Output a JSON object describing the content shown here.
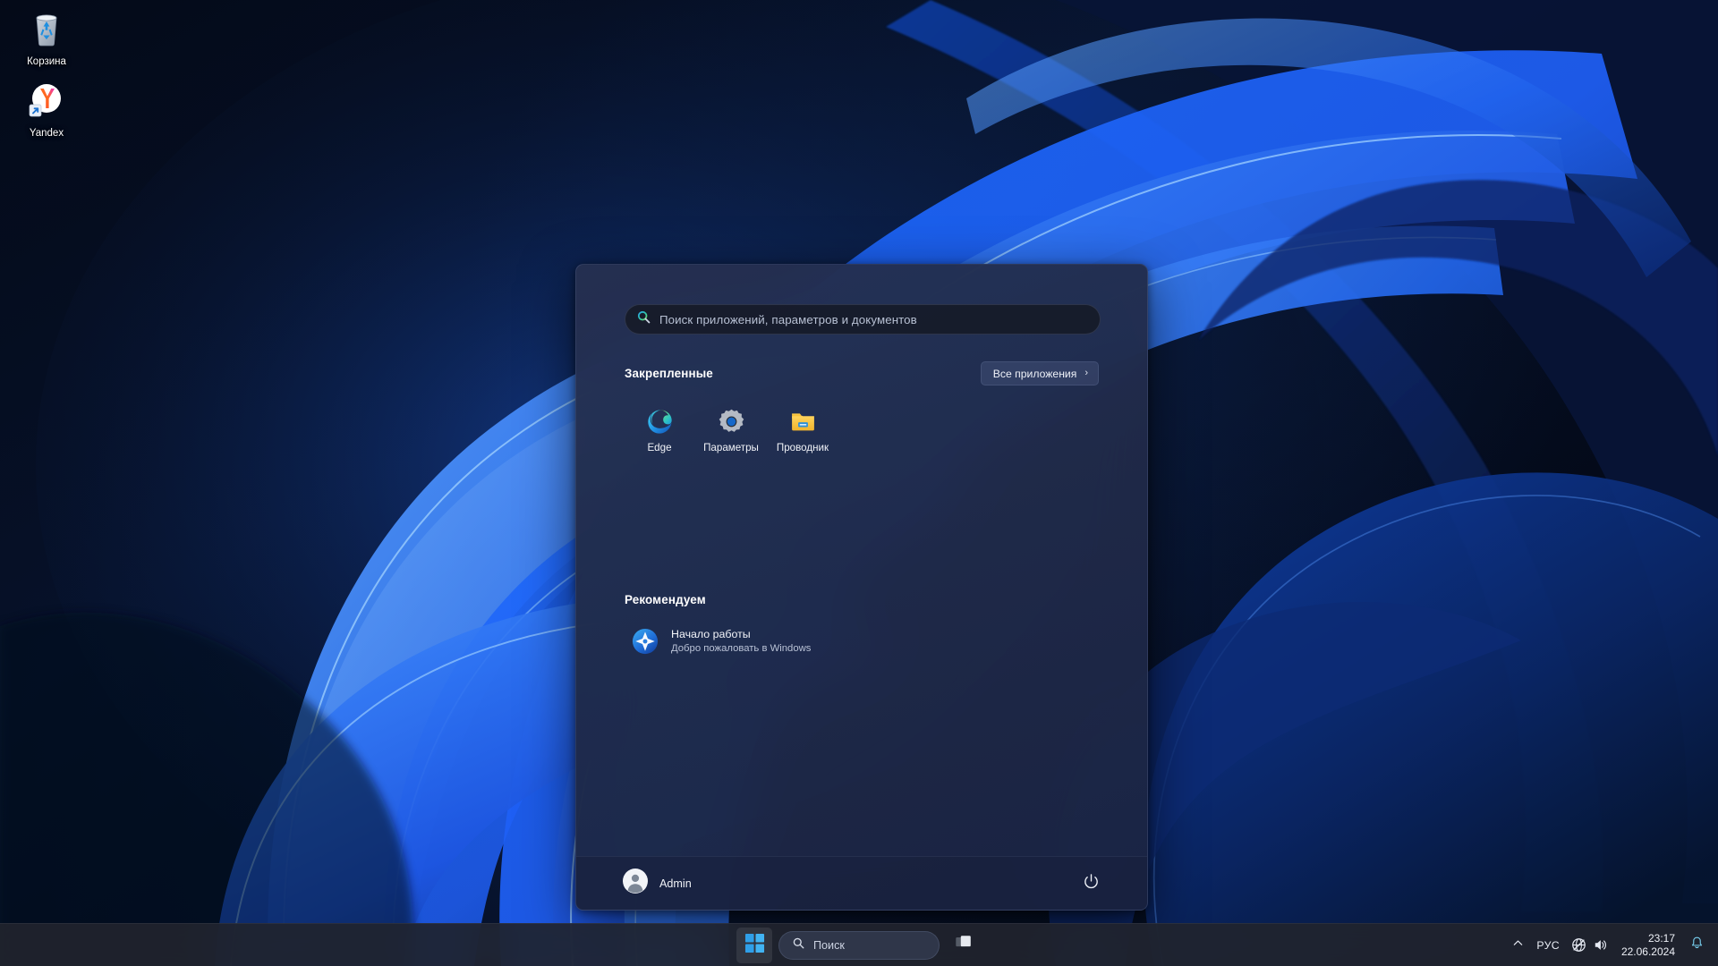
{
  "desktop": {
    "icons": [
      {
        "name": "recycle-bin",
        "label": "Корзина",
        "icon": "recycle-bin-icon"
      },
      {
        "name": "yandex-browser",
        "label": "Yandex",
        "icon": "yandex-icon",
        "shortcut": true
      }
    ]
  },
  "start_menu": {
    "search": {
      "placeholder": "Поиск приложений, параметров и документов",
      "value": "",
      "icon": "search-icon"
    },
    "pinned": {
      "title": "Закрепленные",
      "all_apps_label": "Все приложения",
      "all_apps_chevron": "›",
      "apps": [
        {
          "label": "Edge",
          "icon": "edge-icon"
        },
        {
          "label": "Параметры",
          "icon": "settings-gear-icon"
        },
        {
          "label": "Проводник",
          "icon": "file-explorer-icon"
        }
      ]
    },
    "recommended": {
      "title": "Рекомендуем",
      "items": [
        {
          "title": "Начало работы",
          "subtitle": "Добро пожаловать в Windows",
          "icon": "get-started-icon"
        }
      ]
    },
    "footer": {
      "user_name": "Admin",
      "user_icon": "user-avatar-icon",
      "power_icon": "power-icon"
    }
  },
  "taskbar": {
    "start_button_label": "Пуск",
    "search": {
      "placeholder": "Поиск",
      "value": "",
      "icon": "search-icon"
    },
    "task_view_label": "Представление задач",
    "tray": {
      "overflow_chevron": "⌃",
      "language": "РУС",
      "network_icon": "network-disconnected-icon",
      "volume_icon": "volume-icon",
      "time": "23:17",
      "date": "22.06.2024",
      "notification_icon": "bell-icon"
    }
  },
  "colors": {
    "accent": "#0078d4",
    "start_bg": "#262F4F",
    "taskbar_bg": "#20242D",
    "desktop_bg": "#04060F"
  }
}
